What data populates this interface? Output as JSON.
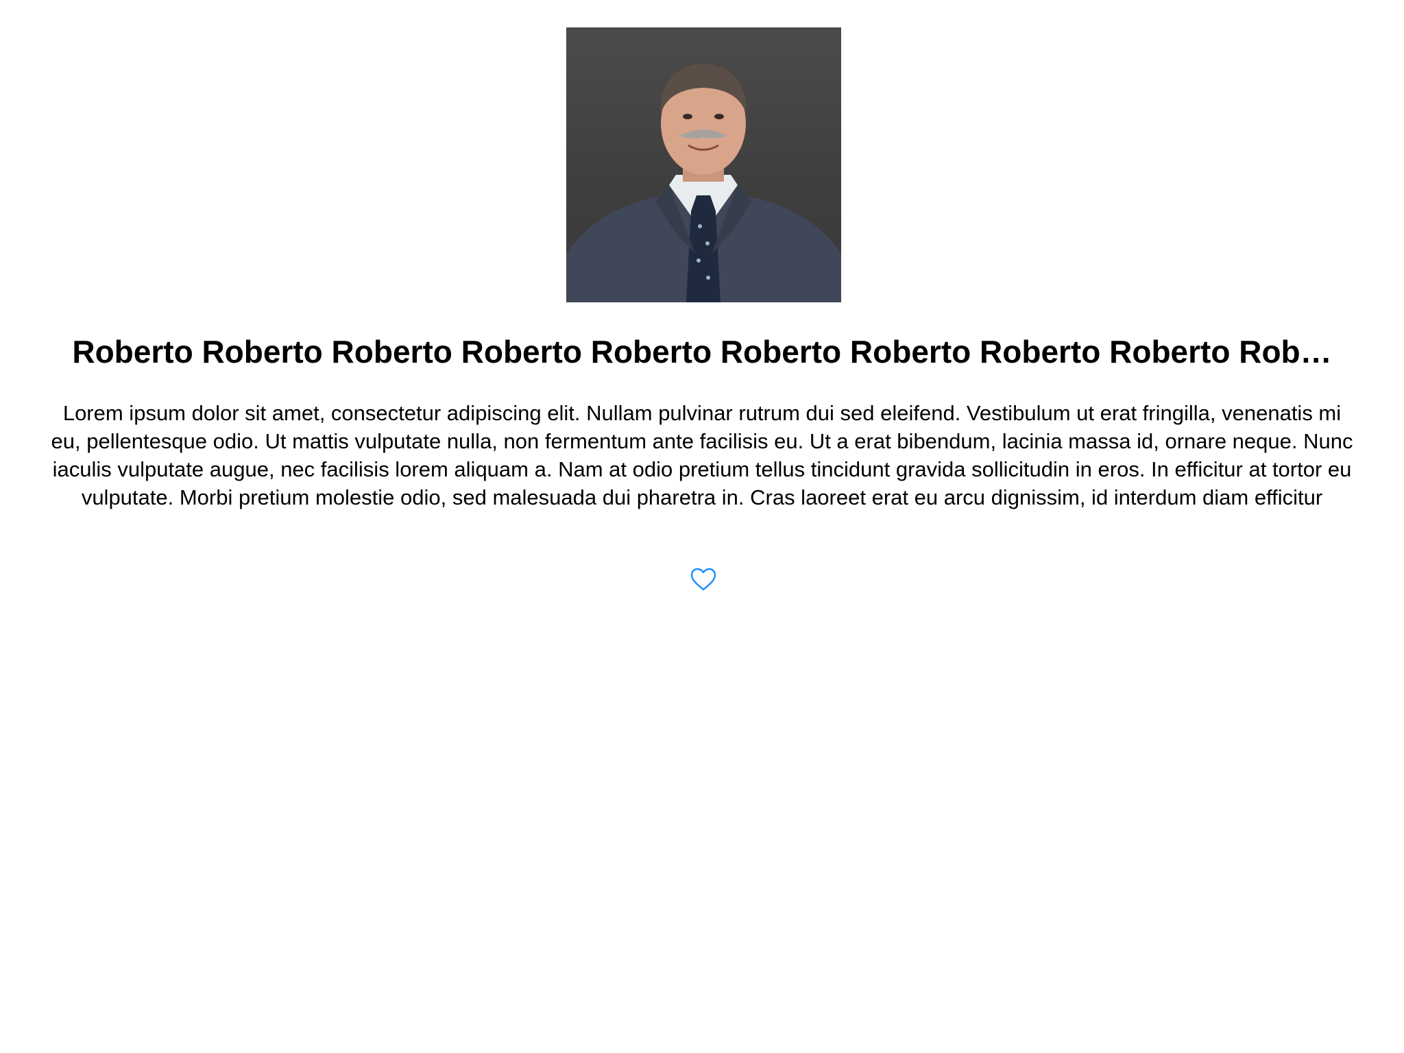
{
  "profile": {
    "photo_icon": "person-portrait-image",
    "name": "Roberto Roberto Roberto Roberto Roberto Roberto Roberto Roberto Roberto Rob…",
    "description": "Lorem ipsum dolor sit amet, consectetur adipiscing elit. Nullam pulvinar rutrum dui sed eleifend. Vestibulum ut erat fringilla, venenatis mi eu, pellentesque odio. Ut mattis vulputate nulla, non fermentum ante facilisis eu. Ut a erat bibendum, lacinia massa id, ornare neque. Nunc iaculis vulputate augue, nec facilisis lorem aliquam a. Nam at odio pretium tellus tincidunt gravida sollicitudin in eros. In efficitur at tortor eu vulputate. Morbi pretium molestie odio, sed malesuada dui pharetra in. Cras laoreet erat eu arcu dignissim, id interdum diam efficitur"
  },
  "actions": {
    "favorite_icon": "heart-outline-icon",
    "accent_color": "#1a8cff"
  }
}
